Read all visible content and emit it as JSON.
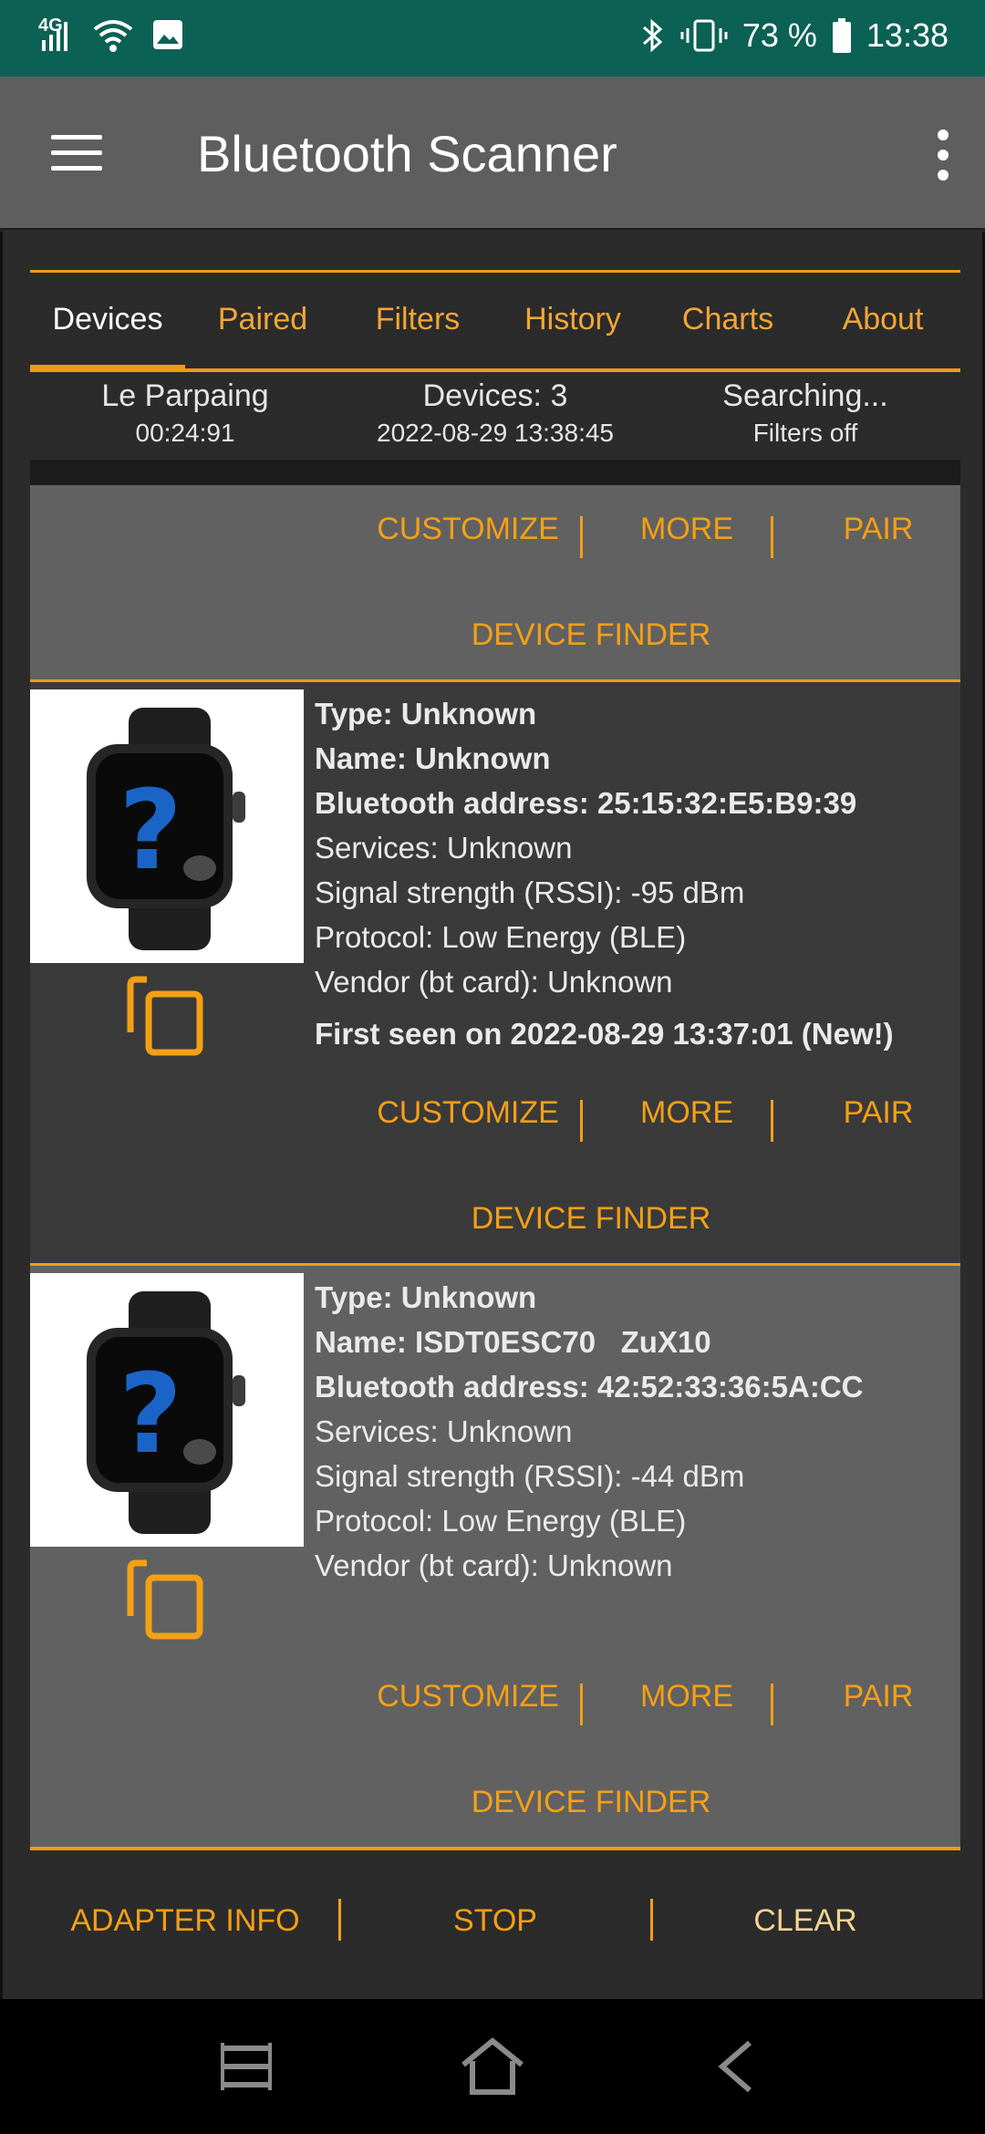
{
  "status_bar": {
    "network": "4G",
    "battery": "73 %",
    "time": "13:38",
    "icons": [
      "signal-icon",
      "wifi-icon",
      "image-icon",
      "bluetooth-icon",
      "vibrate-icon",
      "battery-icon"
    ]
  },
  "app_bar": {
    "title": "Bluetooth Scanner",
    "menu_icon": "hamburger-menu-icon",
    "overflow_icon": "more-vert-icon"
  },
  "tabs": [
    {
      "label": "Devices",
      "active": true
    },
    {
      "label": "Paired"
    },
    {
      "label": "Filters"
    },
    {
      "label": "History"
    },
    {
      "label": "Charts"
    },
    {
      "label": "About"
    }
  ],
  "info": {
    "location": "Le Parpaing",
    "elapsed": "00:24:91",
    "devices": "Devices: 3",
    "datetime": "2022-08-29 13:38:45",
    "status": "Searching...",
    "filters": "Filters off"
  },
  "actions": {
    "customize": "CUSTOMIZE",
    "more": "MORE",
    "pair": "PAIR",
    "device_finder": "DEVICE FINDER"
  },
  "devices": [
    {
      "type": "Type: Unknown",
      "name": "Name: Unknown",
      "address": "Bluetooth address: 25:15:32:E5:B9:39",
      "services": "Services: Unknown",
      "rssi": "Signal strength (RSSI): -95 dBm",
      "protocol": "Protocol: Low Energy (BLE)",
      "vendor": "Vendor (bt card): Unknown",
      "first_seen": "First seen on 2022-08-29 13:37:01 (New!)"
    },
    {
      "type": "Type: Unknown",
      "name": "Name: ISDT0ESC70   ZuX10",
      "address": "Bluetooth address: 42:52:33:36:5A:CC",
      "services": "Services: Unknown",
      "rssi": "Signal strength (RSSI): -44 dBm",
      "protocol": "Protocol: Low Energy (BLE)",
      "vendor": "Vendor (bt card): Unknown"
    }
  ],
  "bottom_bar": {
    "adapter_info": "ADAPTER INFO",
    "stop": "STOP",
    "clear": "CLEAR"
  },
  "colors": {
    "accent": "#f4a016",
    "status_bar": "#0b6154",
    "app_bar": "#5e5e5e",
    "card_dark": "#3a3a3a",
    "card_light": "#616161"
  }
}
